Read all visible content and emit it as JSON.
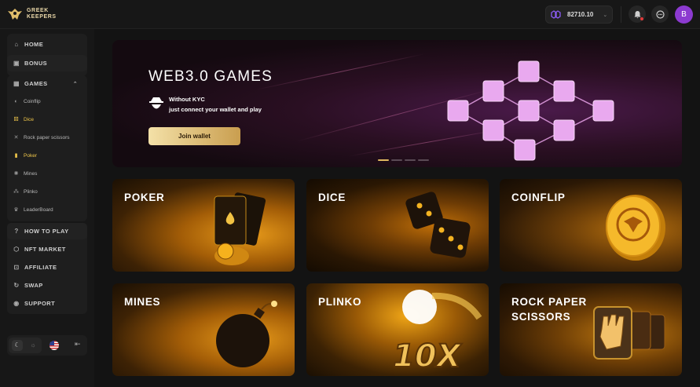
{
  "brand": {
    "line1": "GREEK",
    "line2": "KEEPERS"
  },
  "header": {
    "balance": "82710.10",
    "avatar_letter": "B"
  },
  "colors": {
    "accent_gold": "#f1c84b",
    "avatar": "#8c3ad0",
    "notification_dot": "#e23a3a"
  },
  "sidebar": {
    "home": "HOME",
    "bonus": "BONUS",
    "games": "GAMES",
    "sub_items": [
      "Coinflip",
      "Dice",
      "Rock paper scissors",
      "Poker",
      "Mines",
      "Plinko",
      "LeaderBoard"
    ],
    "how_to_play": "HOW TO PLAY",
    "nft_market": "NFT MARKET",
    "affiliate": "AFFILIATE",
    "swap": "SWAP",
    "support": "SUPPORT"
  },
  "hero": {
    "title": "WEB3.0 GAMES",
    "line1": "Without KYC",
    "line2": "just connect your wallet and play",
    "button": "Join wallet"
  },
  "games": [
    {
      "label": "POKER"
    },
    {
      "label": "DICE"
    },
    {
      "label": "COINFLIP"
    },
    {
      "label": "MINES"
    },
    {
      "label": "PLINKO",
      "art_text": "10X"
    },
    {
      "label": "ROCK PAPER\nSCISSORS"
    }
  ]
}
